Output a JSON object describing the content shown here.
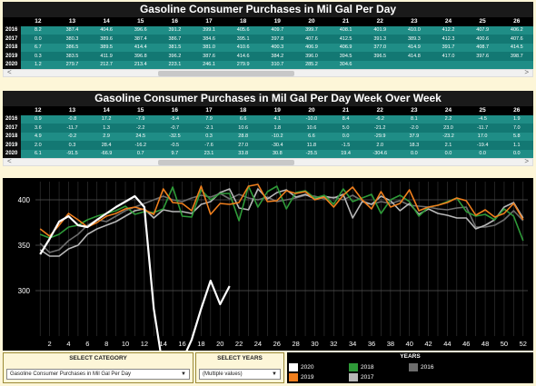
{
  "table1": {
    "title": "Gasoline Consumer Purchases in Mil Gal Per Day",
    "columns": [
      "",
      "12",
      "13",
      "14",
      "15",
      "16",
      "17",
      "18",
      "19",
      "20",
      "21",
      "22",
      "23",
      "24",
      "25",
      "26",
      "27",
      "28"
    ],
    "rows": [
      {
        "year": "2016",
        "cells": [
          "8.2",
          "387.4",
          "404.6",
          "396.6",
          "391.2",
          "399.1",
          "405.6",
          "409.7",
          "399.7",
          "408.1",
          "401.9",
          "410.0",
          "412.2",
          "407.9",
          "406.2",
          "411.0"
        ]
      },
      {
        "year": "2017",
        "cells": [
          "0.0",
          "380.3",
          "389.6",
          "387.4",
          "386.7",
          "384.6",
          "395.1",
          "397.8",
          "407.6",
          "412.5",
          "391.3",
          "389.3",
          "412.3",
          "400.6",
          "407.6",
          "411.0",
          "402.9"
        ]
      },
      {
        "year": "2018",
        "cells": [
          "6.7",
          "386.5",
          "389.5",
          "414.4",
          "381.5",
          "381.0",
          "410.6",
          "400.3",
          "406.9",
          "406.9",
          "377.0",
          "414.9",
          "391.7",
          "408.7",
          "414.5",
          "389.6",
          "407.7"
        ]
      },
      {
        "year": "2019",
        "cells": [
          "0.3",
          "383.5",
          "411.9",
          "396.8",
          "396.2",
          "387.6",
          "414.6",
          "384.2",
          "396.0",
          "394.5",
          "396.5",
          "414.8",
          "417.0",
          "397.6",
          "398.7",
          "409.7",
          "407.0"
        ]
      },
      {
        "year": "2020",
        "cells": [
          "1.2",
          "279.7",
          "212.7",
          "213.4",
          "223.1",
          "246.1",
          "279.9",
          "310.7",
          "285.2",
          "304.6"
        ]
      }
    ]
  },
  "table2": {
    "title": "Gasoline Consumer Purchases in Mil Gal Per Day Week Over Week",
    "columns": [
      "",
      "12",
      "13",
      "14",
      "15",
      "16",
      "17",
      "18",
      "19",
      "20",
      "21",
      "22",
      "23",
      "24",
      "25",
      "26",
      "27",
      "28"
    ],
    "rows": [
      {
        "year": "2016",
        "cells": [
          "0.9",
          "-0.8",
          "17.2",
          "-7.9",
          "-5.4",
          "7.9",
          "6.6",
          "4.1",
          "-10.0",
          "8.4",
          "-6.2",
          "8.1",
          "2.2",
          "-4.5",
          "1.9",
          "-3.5",
          "4.8"
        ]
      },
      {
        "year": "2017",
        "cells": [
          "3.6",
          "-11.7",
          "1.3",
          "-2.2",
          "-0.7",
          "-2.1",
          "10.6",
          "1.8",
          "10.6",
          "5.0",
          "-21.2",
          "-2.0",
          "23.0",
          "-11.7",
          "7.0",
          "3.4",
          "-8.1"
        ]
      },
      {
        "year": "2018",
        "cells": [
          "4.9",
          "-0.2",
          "2.9",
          "24.5",
          "-32.5",
          "0.3",
          "28.8",
          "-10.2",
          "6.6",
          "0.0",
          "-29.9",
          "37.9",
          "-23.2",
          "17.0",
          "5.8",
          "-24.9",
          "18.2"
        ]
      },
      {
        "year": "2019",
        "cells": [
          "2.0",
          "0.3",
          "28.4",
          "-16.2",
          "-0.5",
          "-7.6",
          "27.0",
          "-30.4",
          "11.8",
          "-1.5",
          "2.0",
          "18.3",
          "2.1",
          "-19.4",
          "1.1",
          "11.0",
          "-22.7"
        ]
      },
      {
        "year": "2020",
        "cells": [
          "6.1",
          "-91.5",
          "-66.9",
          "0.7",
          "9.7",
          "23.1",
          "33.8",
          "30.8",
          "-25.5",
          "19.4",
          "-304.6",
          "0.0",
          "0.0",
          "0.0",
          "0.0",
          "0.0",
          "0.0"
        ]
      }
    ]
  },
  "scroll_arrows": {
    "left": "<",
    "right": ">"
  },
  "controls": {
    "category": {
      "label": "SELECT CATEGORY",
      "value": "Gasoline Consumer Purchases in Mil Gal Per Day"
    },
    "years": {
      "label": "SELECT YEARS",
      "value": "(Multiple values)"
    }
  },
  "legend": {
    "title": "YEARS",
    "items": [
      {
        "name": "2020",
        "color": "#ffffff"
      },
      {
        "name": "2019",
        "color": "#f07f1d"
      },
      {
        "name": "2018",
        "color": "#2e9a38"
      },
      {
        "name": "2017",
        "color": "#b8b8b8"
      },
      {
        "name": "2016",
        "color": "#6d6d6d"
      }
    ]
  },
  "chart_data": {
    "type": "line",
    "x_ticks": [
      "2",
      "4",
      "6",
      "8",
      "10",
      "12",
      "14",
      "16",
      "18",
      "20",
      "22",
      "24",
      "26",
      "28",
      "30",
      "32",
      "34",
      "36",
      "38",
      "40",
      "42",
      "44",
      "46",
      "48",
      "50",
      "52"
    ],
    "y_ticks": [
      "300",
      "350",
      "400"
    ],
    "ylim": [
      250,
      420
    ],
    "xlim": [
      0.5,
      52.5
    ],
    "grid": true,
    "series": [
      {
        "name": "2016",
        "color": "#6d6d6d",
        "values": [
          352,
          342,
          345,
          355,
          362,
          372,
          378,
          376,
          382,
          388,
          392,
          396,
          400,
          404,
          400,
          398,
          402,
          405,
          403,
          407,
          401,
          406,
          402,
          400,
          403,
          398,
          400,
          402,
          405,
          404,
          401,
          403,
          400,
          405,
          399,
          395,
          398,
          396,
          399,
          394,
          393,
          392,
          390,
          389,
          391,
          392,
          370,
          370,
          372,
          378,
          388,
          377
        ]
      },
      {
        "name": "2017",
        "color": "#b8b8b8",
        "values": [
          345,
          338,
          338,
          346,
          350,
          362,
          368,
          372,
          376,
          382,
          388,
          390,
          380,
          389,
          387,
          387,
          385,
          395,
          398,
          408,
          412,
          391,
          389,
          412,
          401,
          408,
          411,
          403,
          406,
          401,
          404,
          402,
          406,
          380,
          398,
          395,
          404,
          399,
          388,
          396,
          384,
          390,
          385,
          383,
          380,
          380,
          368,
          372,
          378,
          392,
          397,
          380
        ]
      },
      {
        "name": "2018",
        "color": "#2e9a38",
        "values": [
          362,
          358,
          362,
          370,
          372,
          378,
          382,
          385,
          388,
          393,
          384,
          387,
          386,
          390,
          414,
          382,
          381,
          411,
          400,
          407,
          407,
          377,
          415,
          392,
          409,
          415,
          390,
          408,
          410,
          402,
          405,
          395,
          412,
          398,
          402,
          406,
          385,
          400,
          405,
          398,
          382,
          392,
          394,
          398,
          402,
          387,
          382,
          384,
          378,
          390,
          382,
          355
        ]
      },
      {
        "name": "2019",
        "color": "#f07f1d",
        "values": [
          368,
          360,
          372,
          385,
          378,
          370,
          375,
          382,
          385,
          390,
          392,
          389,
          384,
          412,
          397,
          396,
          388,
          415,
          384,
          396,
          395,
          397,
          415,
          417,
          398,
          399,
          410,
          407,
          409,
          400,
          403,
          392,
          405,
          414,
          400,
          390,
          409,
          392,
          396,
          411,
          388,
          392,
          394,
          397,
          402,
          399,
          383,
          389,
          381,
          385,
          396,
          378
        ]
      },
      {
        "name": "2020",
        "color": "#ffffff",
        "values": [
          340,
          357,
          376,
          382,
          372,
          370,
          378,
          385,
          392,
          398,
          404,
          392,
          280,
          213,
          213,
          223,
          246,
          280,
          311,
          285,
          305,
          null,
          null,
          null,
          null,
          null,
          null,
          null,
          null,
          null,
          null,
          null,
          null,
          null,
          null,
          null,
          null,
          null,
          null,
          null,
          null,
          null,
          null,
          null,
          null,
          null,
          null,
          null,
          null,
          null,
          null,
          null
        ]
      }
    ]
  }
}
